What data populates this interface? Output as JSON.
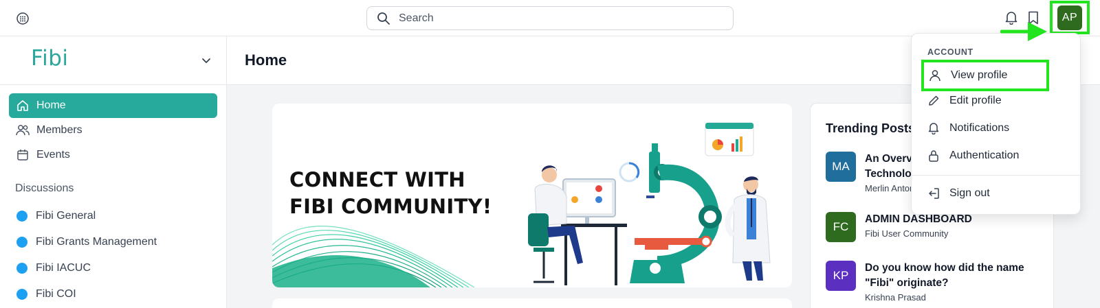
{
  "topbar": {
    "search_placeholder": "Search",
    "avatar_initials": "AP"
  },
  "sidebar": {
    "logo": "Fibi",
    "nav": [
      {
        "label": "Home",
        "icon": "home-icon",
        "active": true
      },
      {
        "label": "Members",
        "icon": "users-icon",
        "active": false
      },
      {
        "label": "Events",
        "icon": "calendar-icon",
        "active": false
      }
    ],
    "discussions_title": "Discussions",
    "discussions": [
      {
        "label": "Fibi General"
      },
      {
        "label": "Fibi Grants Management"
      },
      {
        "label": "Fibi IACUC"
      },
      {
        "label": "Fibi COI"
      }
    ]
  },
  "main": {
    "title": "Home",
    "banner": {
      "line1": "CONNECT WITH",
      "line2": "FIBI COMMUNITY!"
    },
    "trending": {
      "title": "Trending Posts",
      "posts": [
        {
          "initials": "MA",
          "color": "#1f6e9c",
          "title": "An Overview of the Fibi Technology Stack",
          "meta": "Merlin Antony"
        },
        {
          "initials": "FC",
          "color": "#2f6b1f",
          "title": "ADMIN DASHBOARD",
          "meta": "Fibi User Community"
        },
        {
          "initials": "KP",
          "color": "#5b2fc0",
          "title": "Do you know how did the name \"Fibi\" originate?",
          "meta": "Krishna Prasad"
        }
      ]
    }
  },
  "account_menu": {
    "section_label": "ACCOUNT",
    "items": [
      {
        "label": "View profile",
        "icon": "user-icon"
      },
      {
        "label": "Edit profile",
        "icon": "pencil-icon"
      },
      {
        "label": "Notifications",
        "icon": "bell-icon"
      },
      {
        "label": "Authentication",
        "icon": "lock-icon"
      }
    ],
    "sign_out": "Sign out"
  },
  "colors": {
    "accent": "#27a99b",
    "highlight": "#22e51f",
    "discussion_dot": "#1ea0f2"
  }
}
